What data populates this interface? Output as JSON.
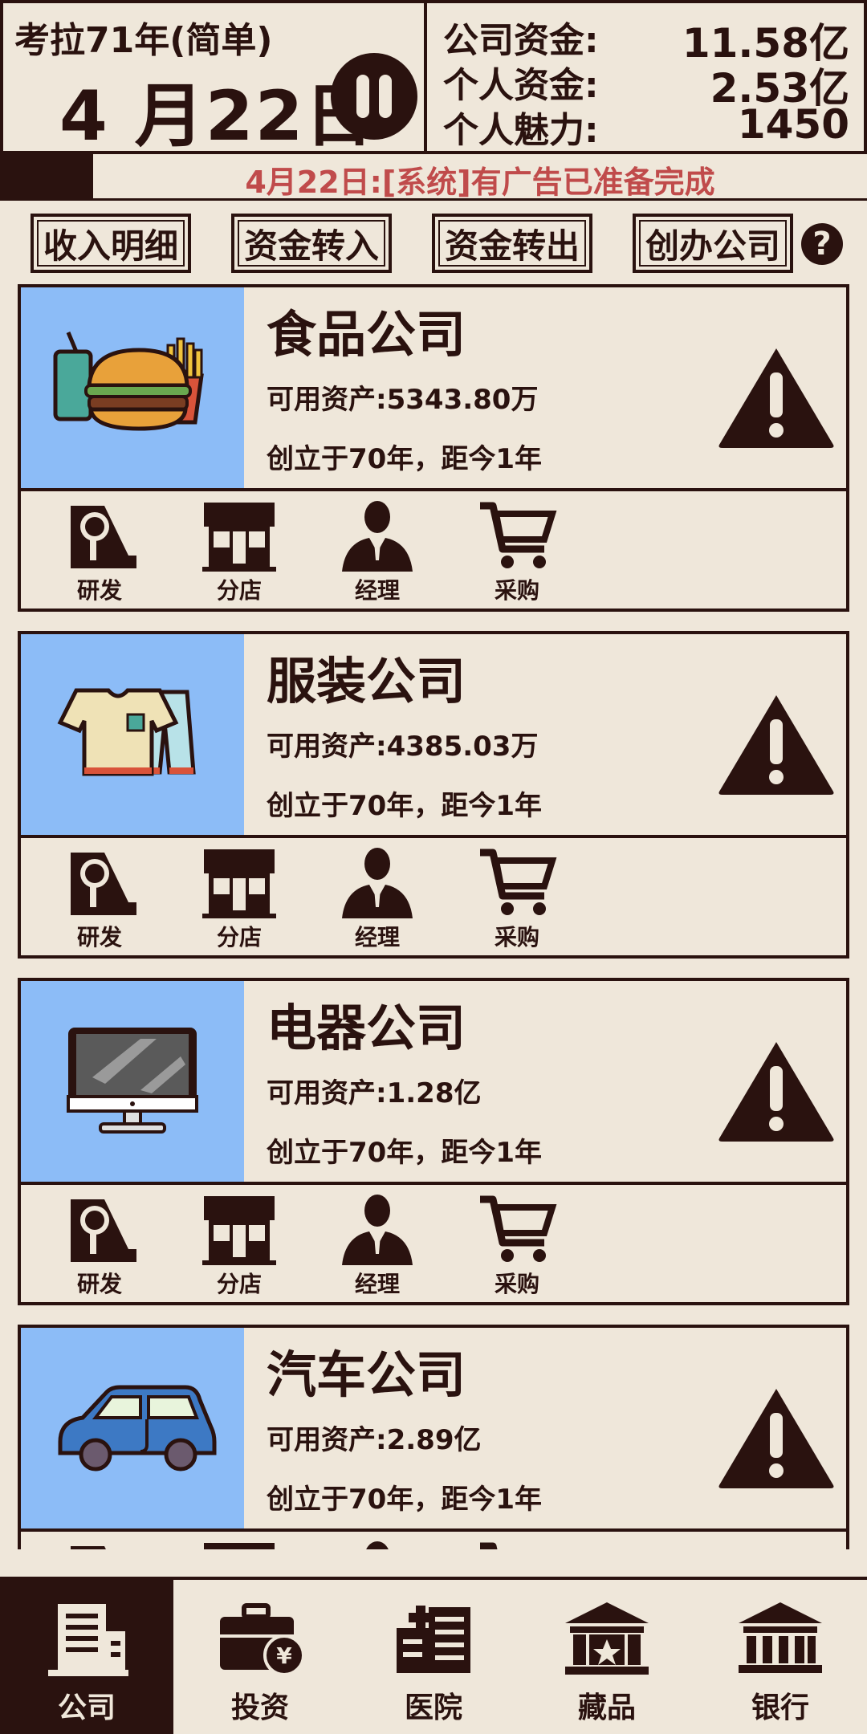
{
  "header": {
    "difficulty": "考拉71年(简单)",
    "date": "4 月22日",
    "stats": [
      {
        "label": "公司资金:",
        "value": "11.58亿"
      },
      {
        "label": "个人资金:",
        "value": "2.53亿"
      },
      {
        "label": "个人魅力:",
        "value": "1450"
      }
    ]
  },
  "message": "4月22日:[系统]有广告已准备完成",
  "buttons": [
    "收入明细",
    "资金转入",
    "资金转出",
    "创办公司"
  ],
  "help": "?",
  "companies": [
    {
      "name": "食品公司",
      "assets": "可用资产:5343.80万",
      "founded": "创立于70年，距今1年",
      "icon": "burger-icon"
    },
    {
      "name": "服装公司",
      "assets": "可用资产:4385.03万",
      "founded": "创立于70年，距今1年",
      "icon": "clothes-icon"
    },
    {
      "name": "电器公司",
      "assets": "可用资产:1.28亿",
      "founded": "创立于70年，距今1年",
      "icon": "monitor-icon"
    },
    {
      "name": "汽车公司",
      "assets": "可用资产:2.89亿",
      "founded": "创立于70年，距今1年",
      "icon": "car-icon"
    }
  ],
  "actions": [
    "研发",
    "分店",
    "经理",
    "采购"
  ],
  "nav": [
    {
      "label": "公司",
      "icon": "office-building-icon",
      "active": true
    },
    {
      "label": "投资",
      "icon": "briefcase-yen-icon",
      "active": false
    },
    {
      "label": "医院",
      "icon": "hospital-icon",
      "active": false
    },
    {
      "label": "藏品",
      "icon": "museum-icon",
      "active": false
    },
    {
      "label": "银行",
      "icon": "bank-icon",
      "active": false
    }
  ],
  "colors": {
    "ink": "#2a120f",
    "paper": "#efe7da",
    "thumb_bg": "#8cbcf7",
    "message_red": "#c04b4b"
  }
}
